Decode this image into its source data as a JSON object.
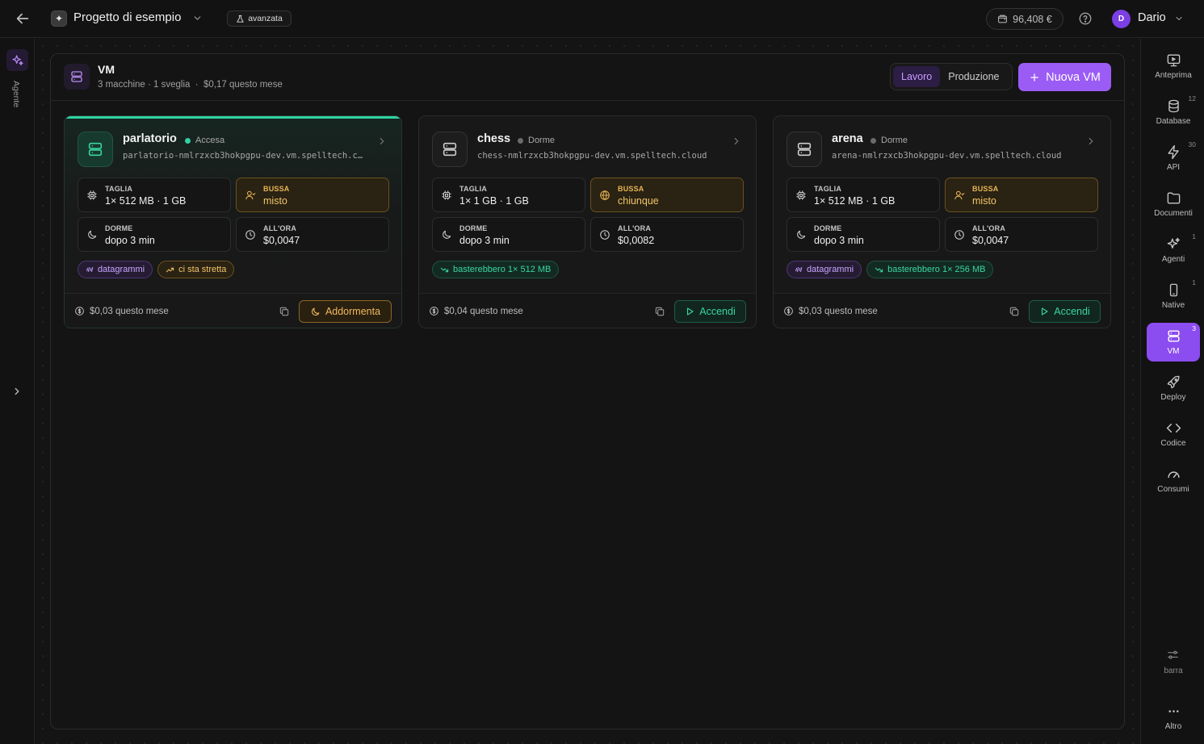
{
  "topbar": {
    "project_name": "Progetto di esempio",
    "mode_badge": "avanzata",
    "credit": "96,408 €",
    "user_initial": "D",
    "user_name": "Dario"
  },
  "left_rail": {
    "agent_label": "Agente"
  },
  "header": {
    "title": "VM",
    "subtitle": "3 macchine · 1 sveglia  ·  $0,17 questo mese",
    "env_options": [
      "Lavoro",
      "Produzione"
    ],
    "env_selected": "Lavoro",
    "new_vm_label": "Nuova VM"
  },
  "vms": [
    {
      "name": "parlatorio",
      "status": "Accesa",
      "host": "parlatorio-nmlrzxcb3hokpgpu-dev.vm.spelltech.clo…",
      "size_label": "TAGLIA",
      "size_value": "1× 512 MB · 1 GB",
      "knock_label": "BUSSA",
      "knock_value": "misto",
      "sleep_label": "DORME",
      "sleep_value": "dopo 3 min",
      "rate_label": "ALL'ORA",
      "rate_value": "$0,0047",
      "tags": [
        {
          "text": "datagrammi",
          "tone": "purple"
        },
        {
          "text": "ci sta stretta",
          "tone": "amber"
        }
      ],
      "cost": "$0,03 questo mese",
      "action": "Addormenta"
    },
    {
      "name": "chess",
      "status": "Dorme",
      "host": "chess-nmlrzxcb3hokpgpu-dev.vm.spelltech.cloud",
      "size_label": "TAGLIA",
      "size_value": "1× 1 GB · 1 GB",
      "knock_label": "BUSSA",
      "knock_value": "chiunque",
      "sleep_label": "DORME",
      "sleep_value": "dopo 3 min",
      "rate_label": "ALL'ORA",
      "rate_value": "$0,0082",
      "tags": [
        {
          "text": "basterebbero 1× 512 MB",
          "tone": "green"
        }
      ],
      "cost": "$0,04 questo mese",
      "action": "Accendi"
    },
    {
      "name": "arena",
      "status": "Dorme",
      "host": "arena-nmlrzxcb3hokpgpu-dev.vm.spelltech.cloud",
      "size_label": "TAGLIA",
      "size_value": "1× 512 MB · 1 GB",
      "knock_label": "BUSSA",
      "knock_value": "misto",
      "sleep_label": "DORME",
      "sleep_value": "dopo 3 min",
      "rate_label": "ALL'ORA",
      "rate_value": "$0,0047",
      "tags": [
        {
          "text": "datagrammi",
          "tone": "purple"
        },
        {
          "text": "basterebbero 1× 256 MB",
          "tone": "green"
        }
      ],
      "cost": "$0,03 questo mese",
      "action": "Accendi"
    }
  ],
  "right_rail": {
    "items": [
      {
        "label": "Anteprima",
        "icon": "preview-icon",
        "count": ""
      },
      {
        "label": "Database",
        "icon": "database-icon",
        "count": "12"
      },
      {
        "label": "API",
        "icon": "bolt-icon",
        "count": "30"
      },
      {
        "label": "Documenti",
        "icon": "folder-icon",
        "count": ""
      },
      {
        "label": "Agenti",
        "icon": "sparkle-icon",
        "count": "1"
      },
      {
        "label": "Native",
        "icon": "phone-icon",
        "count": "1"
      },
      {
        "label": "VM",
        "icon": "server-icon",
        "count": "3"
      },
      {
        "label": "Deploy",
        "icon": "rocket-icon",
        "count": ""
      },
      {
        "label": "Codice",
        "icon": "code-icon",
        "count": ""
      },
      {
        "label": "Consumi",
        "icon": "gauge-icon",
        "count": ""
      }
    ],
    "bar_label": "barra",
    "more_label": "Altro"
  },
  "colors": {
    "accent": "#9b5cf6",
    "running": "#2fd3a1",
    "warning": "#e6b455"
  }
}
